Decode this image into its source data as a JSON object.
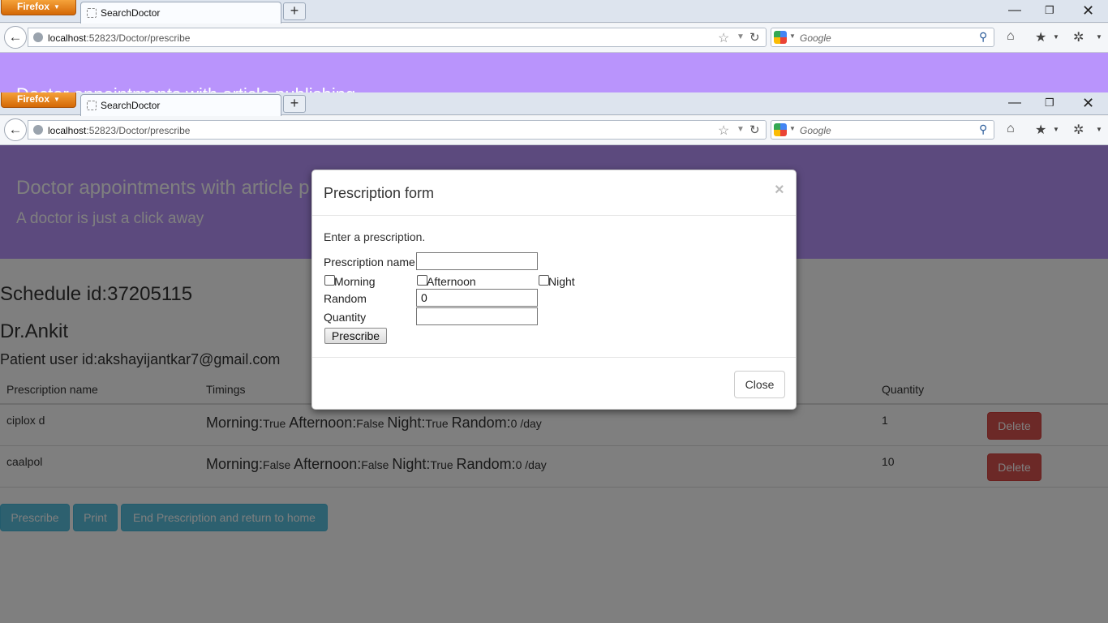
{
  "browser": {
    "app_button": "Firefox",
    "tab_title": "SearchDoctor",
    "new_tab": "+",
    "url_host": "localhost",
    "url_path": ":52823/Doctor/prescribe",
    "search_placeholder": "Google"
  },
  "page": {
    "jumbotron_title": "Doctor appointments with article publishing",
    "jumbotron_title_visible": "Doctor appointments with article p",
    "jumbotron_subtitle": "A doctor is just a click away",
    "schedule": "Schedule id:37205115",
    "doctor": "Dr.Ankit",
    "patient": "Patient user id:akshayijantkar7@gmail.com",
    "table": {
      "headers": [
        "Prescription name",
        "Timings",
        "Quantity"
      ],
      "rows": [
        {
          "name": "ciplox d",
          "morning_label": "Morning:",
          "morning": "True",
          "afternoon_label": "Afternoon:",
          "afternoon": "False",
          "night_label": "Night:",
          "night": "True",
          "random_label": "Random:",
          "random": "0 /day",
          "quantity": "1",
          "delete": "Delete"
        },
        {
          "name": "caalpol",
          "morning_label": "Morning:",
          "morning": "False",
          "afternoon_label": "Afternoon:",
          "afternoon": "False",
          "night_label": "Night:",
          "night": "True",
          "random_label": "Random:",
          "random": "0 /day",
          "quantity": "10",
          "delete": "Delete"
        }
      ]
    },
    "buttons": {
      "prescribe": "Prescribe",
      "print": "Print",
      "end": "End Prescription and return to home"
    }
  },
  "modal": {
    "title": "Prescription form",
    "close_x": "×",
    "intro": "Enter a prescription.",
    "name_label": "Prescription name",
    "name_value": "",
    "morning_label": "Morning",
    "afternoon_label": "Afternoon",
    "night_label": "Night",
    "random_label": "Random",
    "random_value": "0",
    "quantity_label": "Quantity",
    "quantity_value": "",
    "submit": "Prescribe",
    "close": "Close"
  },
  "colors": {
    "jumbotron": "#b994fc",
    "danger": "#d9534f",
    "info": "#5bc0de"
  }
}
